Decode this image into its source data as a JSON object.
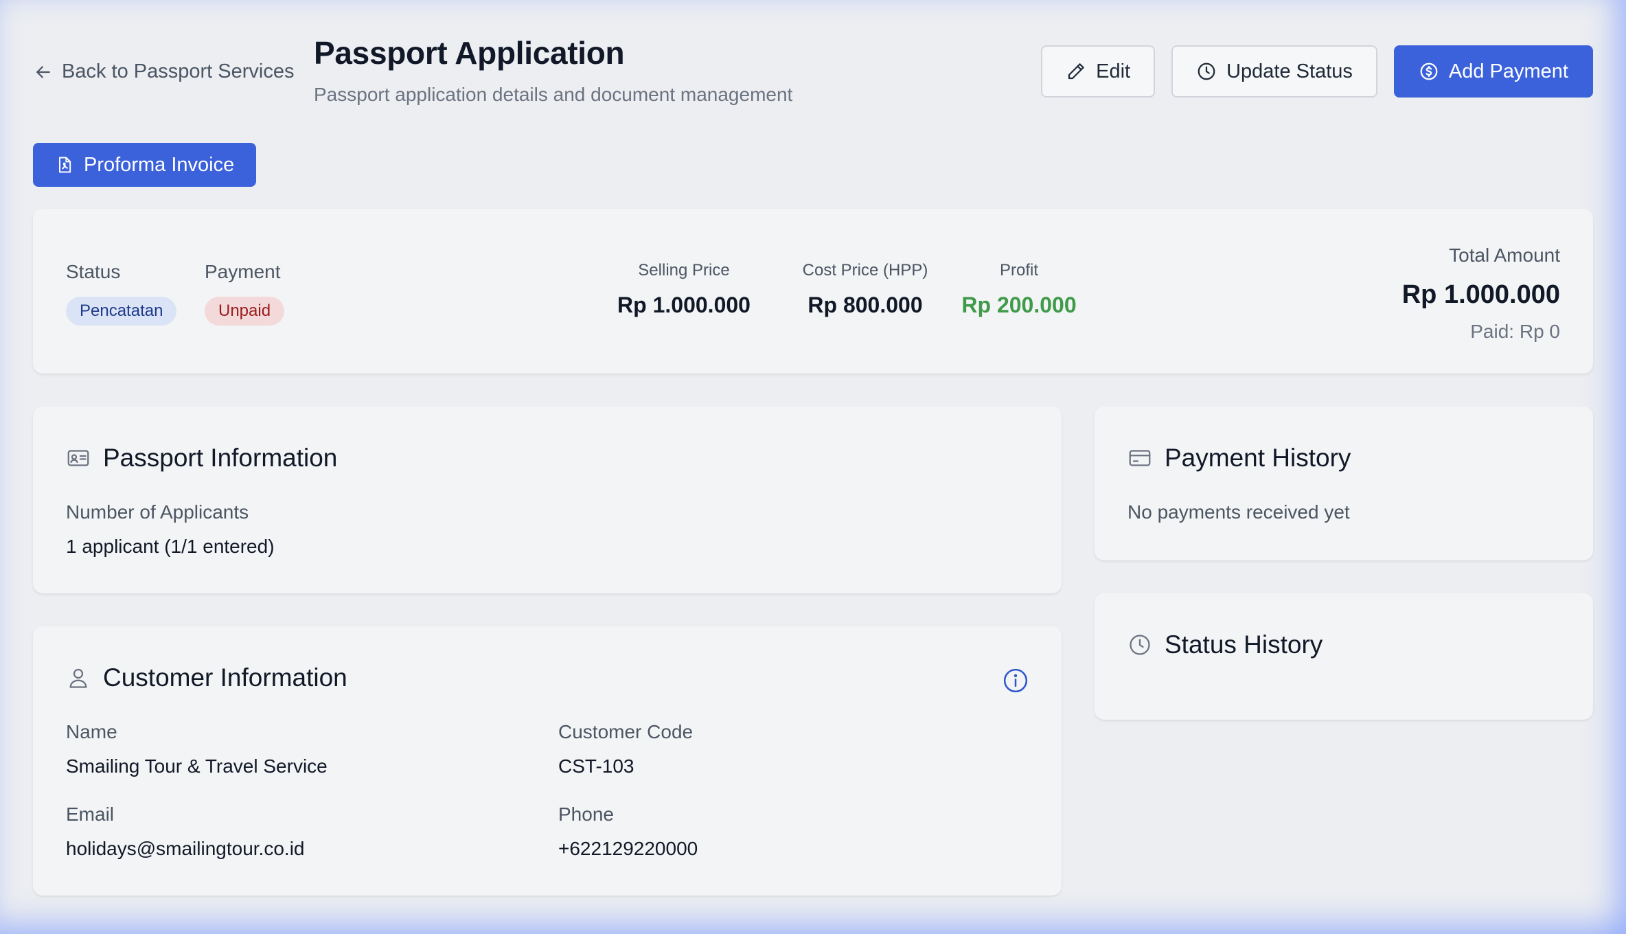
{
  "header": {
    "back_label": "Back to Passport Services",
    "title": "Passport Application",
    "subtitle": "Passport application details and document management",
    "edit_label": "Edit",
    "update_status_label": "Update Status",
    "add_payment_label": "Add Payment"
  },
  "invoice_button_label": "Proforma Invoice",
  "summary": {
    "status_label": "Status",
    "status_value": "Pencatatan",
    "payment_label": "Payment",
    "payment_value": "Unpaid",
    "selling_price_label": "Selling Price",
    "selling_price_value": "Rp 1.000.000",
    "cost_price_label": "Cost Price (HPP)",
    "cost_price_value": "Rp 800.000",
    "profit_label": "Profit",
    "profit_value": "Rp 200.000",
    "total_amount_label": "Total Amount",
    "total_amount_value": "Rp 1.000.000",
    "paid_text": "Paid: Rp 0"
  },
  "passport_info": {
    "title": "Passport Information",
    "applicants_label": "Number of Applicants",
    "applicants_value": "1 applicant (1/1 entered)"
  },
  "customer_info": {
    "title": "Customer Information",
    "name_label": "Name",
    "name_value": "Smailing Tour & Travel Service",
    "code_label": "Customer Code",
    "code_value": "CST-103",
    "email_label": "Email",
    "email_value": "holidays@smailingtour.co.id",
    "phone_label": "Phone",
    "phone_value": "+622129220000"
  },
  "payment_history": {
    "title": "Payment History",
    "empty_text": "No payments received yet"
  },
  "status_history": {
    "title": "Status History"
  },
  "colors": {
    "primary": "#3b62db",
    "profit": "#3f9a4a",
    "status_badge_bg": "#dbe4f6",
    "payment_badge_bg": "#f3d9d9"
  },
  "icons": [
    "arrow-left-icon",
    "pencil-icon",
    "clock-icon",
    "dollar-circle-icon",
    "file-pdf-icon",
    "id-card-icon",
    "user-icon",
    "info-icon",
    "credit-card-icon"
  ]
}
